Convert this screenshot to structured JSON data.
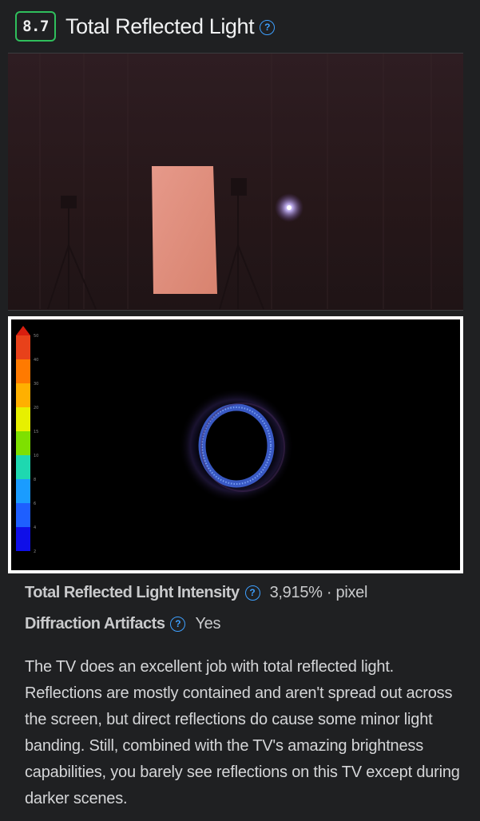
{
  "header": {
    "score": "8.7",
    "title": "Total Reflected Light",
    "help_icon": "question-circle-icon"
  },
  "photo": {
    "description_icon": "test-photo",
    "background_color": "#2a1b1e",
    "panel_color": "#e08f80"
  },
  "heatmap": {
    "scale_labels": [
      "50",
      "40",
      "30",
      "20",
      "15",
      "10",
      "8",
      "6",
      "4",
      "2"
    ],
    "scale_colors": [
      "#e83a12",
      "#ff7a00",
      "#ffb000",
      "#e7f000",
      "#8ee000",
      "#22e05a",
      "#12d8d8",
      "#1a9cff",
      "#1e5fff",
      "#1a2cff",
      "#0a0aff"
    ],
    "ring_color": "#4a78e8"
  },
  "specs": [
    {
      "label": "Total Reflected Light Intensity",
      "value": "3,915% · pixel",
      "help_icon": "question-circle-icon"
    },
    {
      "label": "Diffraction Artifacts",
      "value": "Yes",
      "help_icon": "question-circle-icon"
    }
  ],
  "description": "The TV does an excellent job with total reflected light. Reflections are mostly contained and aren't spread out across the screen, but direct reflections do cause some minor light banding. Still, combined with the TV's amazing brightness capabilities, you barely see reflections on this TV except during darker scenes.",
  "colors": {
    "background": "#1f2022",
    "accent_score": "#2fbf5c",
    "help_blue": "#3ea0ff"
  }
}
